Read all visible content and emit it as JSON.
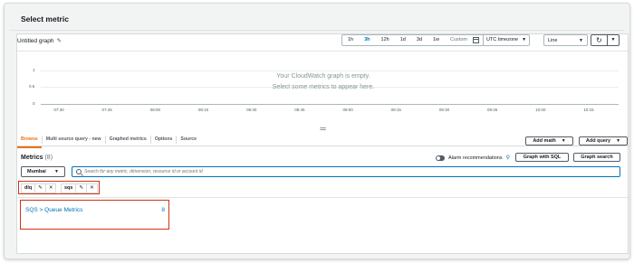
{
  "header": {
    "title": "Select metric"
  },
  "graph": {
    "title": "Untitled graph",
    "time_ranges": [
      "1h",
      "3h",
      "12h",
      "1d",
      "3d",
      "1w"
    ],
    "active_range": "3h",
    "custom_label": "Custom",
    "timezone": "UTC timezone",
    "chart_type": "Line",
    "empty_line1": "Your CloudWatch graph is empty.",
    "empty_line2": "Select some metrics to appear here.",
    "y_ticks": [
      "1",
      "0.5",
      "0"
    ],
    "x_ticks": [
      "07:30",
      "07:45",
      "08:00",
      "08:15",
      "08:30",
      "08:45",
      "09:00",
      "09:15",
      "09:30",
      "09:45",
      "10:00",
      "10:15"
    ]
  },
  "tabs": [
    {
      "label": "Browse",
      "active": true
    },
    {
      "label": "Multi source query - new",
      "active": false
    },
    {
      "label": "Graphed metrics",
      "active": false
    },
    {
      "label": "Options",
      "active": false
    },
    {
      "label": "Source",
      "active": false
    }
  ],
  "actions": {
    "add_math": "Add math",
    "add_query": "Add query"
  },
  "metrics": {
    "label": "Metrics",
    "count": "(8)",
    "alarm_label": "Alarm recommendations",
    "graph_sql": "Graph with SQL",
    "graph_search": "Graph search",
    "region": "Mumbai",
    "search_placeholder": "Search for any metric, dimension, resource id or account id"
  },
  "filters": [
    {
      "label": "dlq"
    },
    {
      "label": "sqs"
    }
  ],
  "results": [
    {
      "label": "SQS > Queue Metrics",
      "count": "8"
    }
  ],
  "colors": {
    "accent_orange": "#ec7211",
    "link_blue": "#0073bb",
    "highlight_red": "#d13212"
  }
}
